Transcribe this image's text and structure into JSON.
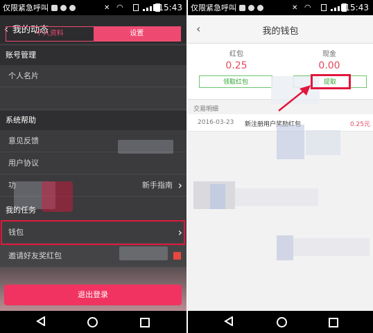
{
  "status_bar": {
    "carrier": "仅限紧急呼叫",
    "time": "15:43"
  },
  "left": {
    "header_title": "我的动态",
    "tabs": [
      {
        "label": "个人资料",
        "active": false
      },
      {
        "label": "设置",
        "active": true
      }
    ],
    "sections": [
      {
        "title": "账号管理",
        "items": [
          {
            "label": "个人名片"
          },
          {
            "label": ""
          }
        ]
      },
      {
        "title": "系统帮助",
        "items": [
          {
            "label": "意见反馈"
          },
          {
            "label": "用户协议"
          },
          {
            "label": "功",
            "right": "新手指南"
          }
        ]
      },
      {
        "title": "我的任务",
        "items": [
          {
            "label": "钱包",
            "highlighted": true
          },
          {
            "label": "邀请好友奖红包"
          }
        ]
      }
    ],
    "logout_label": "退出登录",
    "accent_color": "#f03360",
    "highlight_color": "#e1173c"
  },
  "right": {
    "title": "我的钱包",
    "red_packet": {
      "label": "红包",
      "value": "0.25",
      "button": "领取红包"
    },
    "cash": {
      "label": "现金",
      "value": "0.00",
      "button": "提取"
    },
    "transactions_label": "交易明细",
    "transactions": [
      {
        "date": "2016-03-23",
        "desc": "新注册用户奖励红包",
        "amount": "0.25元"
      }
    ]
  },
  "nav_icons": [
    "back-icon",
    "home-icon",
    "recent-apps-icon"
  ]
}
